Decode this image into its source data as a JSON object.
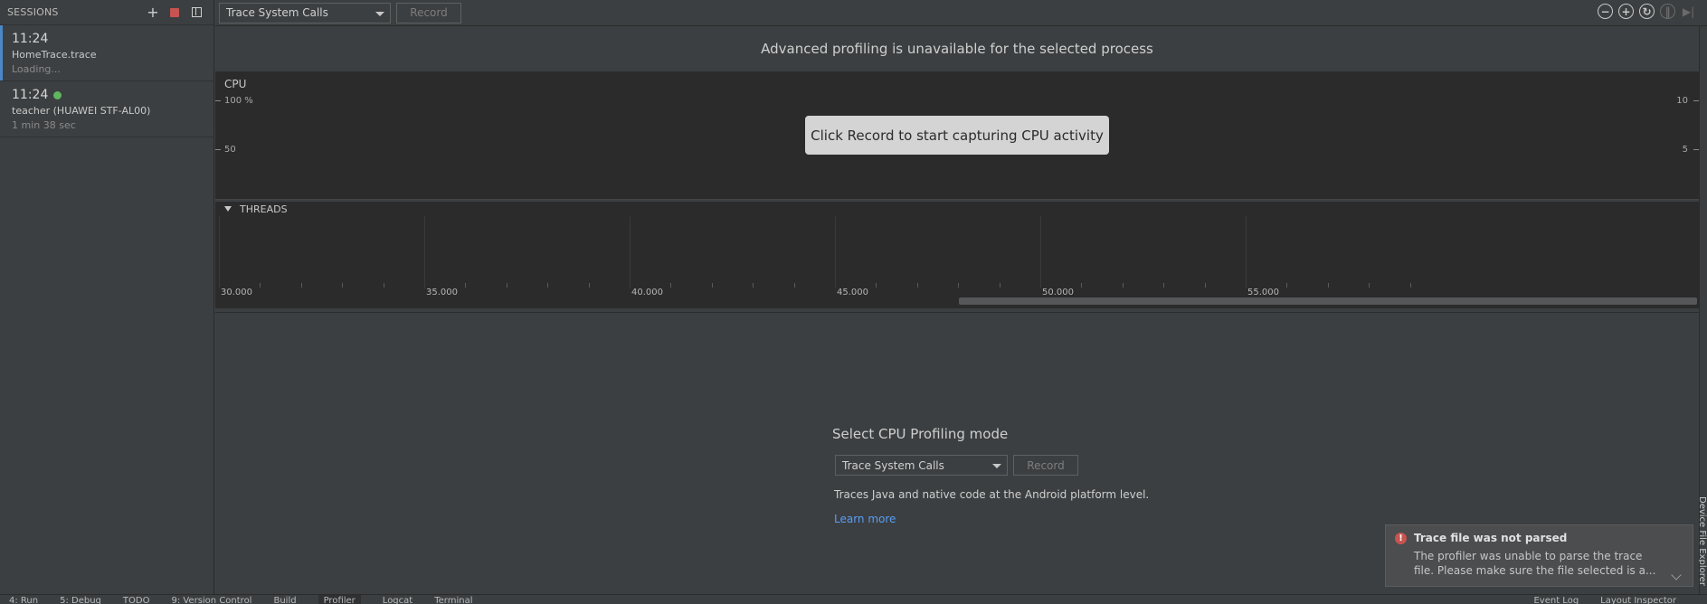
{
  "sidebar": {
    "title": "SESSIONS",
    "add_icon": "plus-icon",
    "sessions": [
      {
        "time": "11:24",
        "name": "HomeTrace.trace",
        "sub": "Loading..."
      },
      {
        "time": "11:24",
        "name": "teacher (HUAWEI STF-AL00)",
        "sub": "1 min 38 sec",
        "live": true
      }
    ]
  },
  "toolbar": {
    "mode_select": "Trace System Calls",
    "record_label": "Record"
  },
  "banner": "Advanced profiling is unavailable for the selected process",
  "cpu": {
    "label": "CPU",
    "y_left": [
      "100 %",
      "50"
    ],
    "y_right": [
      "10",
      "5"
    ],
    "hint": "Click Record to start capturing CPU activity"
  },
  "threads": {
    "label": "THREADS",
    "ticks": [
      "30.000",
      "35.000",
      "40.000",
      "45.000",
      "50.000",
      "55.000"
    ]
  },
  "lower": {
    "title": "Select CPU Profiling mode",
    "mode_select": "Trace System Calls",
    "record_label": "Record",
    "description": "Traces Java and native code at the Android platform level.",
    "learn_more": "Learn more"
  },
  "right_strip": {
    "tab": "Device File Explorer"
  },
  "notification": {
    "title": "Trace file was not parsed",
    "body": "The profiler was unable to parse the trace file. Please make sure the file selected is a..."
  },
  "bottom_bar": {
    "items": [
      "4: Run",
      "5: Debug",
      "TODO",
      "9: Version Control",
      "Build",
      "Profiler",
      "Logcat",
      "Terminal"
    ],
    "right_items": [
      "Event Log",
      "Layout Inspector"
    ]
  },
  "colors": {
    "accent": "#4a88c7",
    "error": "#c75450",
    "live": "#5fb760",
    "link": "#589df6"
  }
}
